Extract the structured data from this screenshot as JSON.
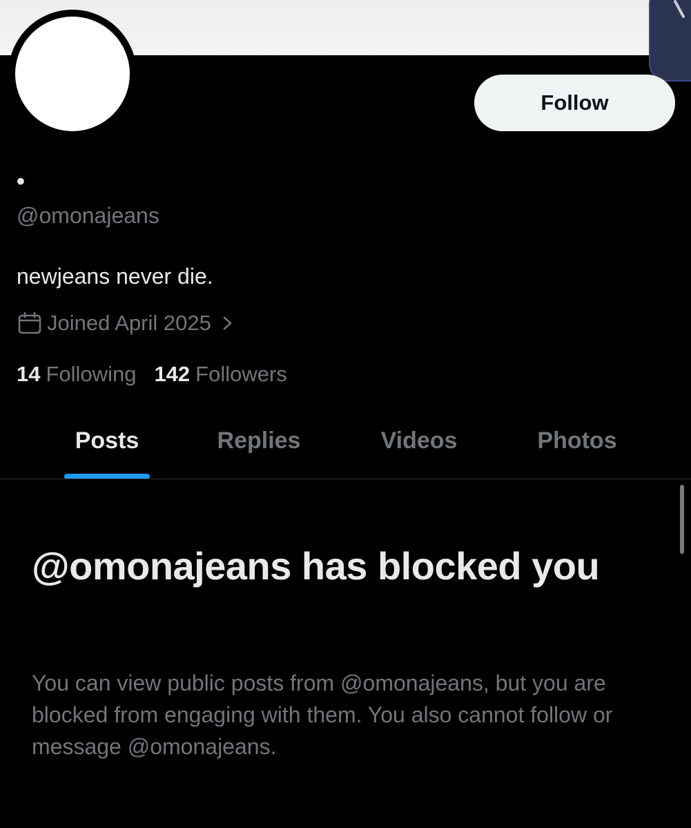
{
  "profile": {
    "display_name": "•",
    "handle": "@omonajeans",
    "bio": "newjeans never die.",
    "joined": "Joined April 2025",
    "following_count": "14",
    "following_label": "Following",
    "followers_count": "142",
    "followers_label": "Followers"
  },
  "actions": {
    "follow_label": "Follow"
  },
  "tabs": [
    {
      "label": "Posts",
      "active": true
    },
    {
      "label": "Replies",
      "active": false
    },
    {
      "label": "Videos",
      "active": false
    },
    {
      "label": "Photos",
      "active": false
    }
  ],
  "blocked": {
    "title": "@omonajeans has blocked you",
    "message": "You can view public posts from @omonajeans, but you are blocked from engaging with them. You also cannot follow or message @omonajeans."
  },
  "colors": {
    "background": "#000000",
    "text_primary": "#e7e9ea",
    "text_secondary": "#71767b",
    "accent": "#1d9bf0",
    "follow_button_bg": "#eff3f4"
  },
  "icons": [
    "calendar-icon",
    "chevron-right-icon",
    "menu-icon"
  ]
}
